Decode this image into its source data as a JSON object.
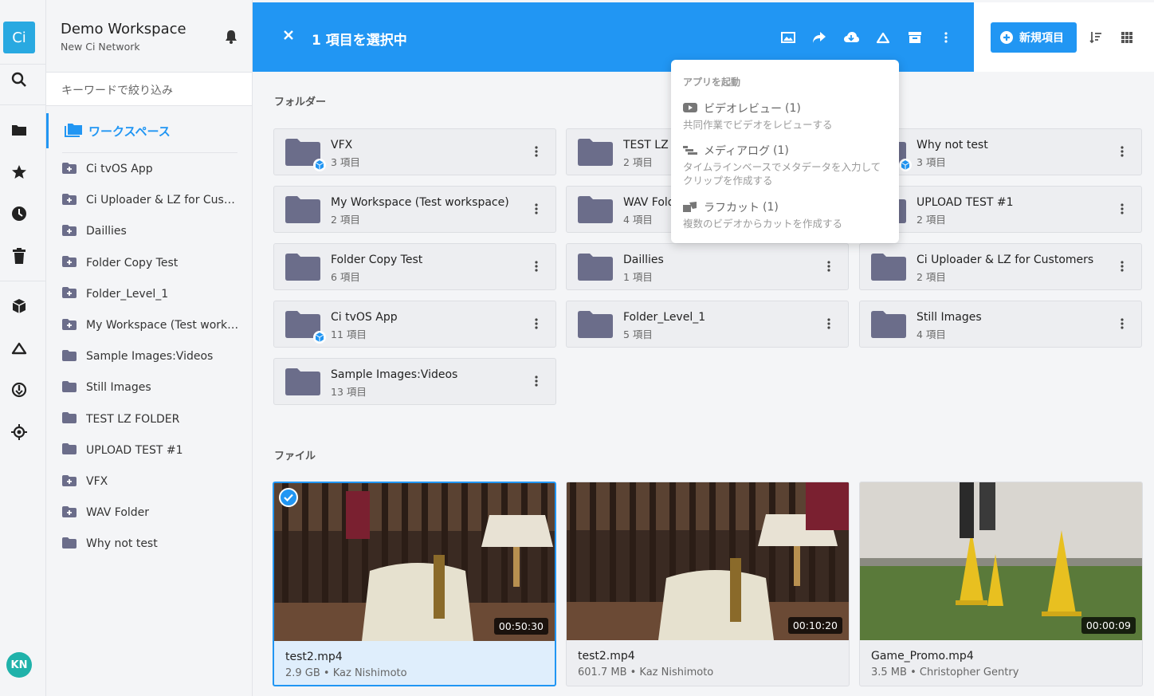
{
  "rail": {
    "logo": "Ci",
    "avatar": "KN",
    "icons": [
      "search-icon",
      "folder-icon",
      "star-icon",
      "clock-icon",
      "trash-icon",
      "cube-icon",
      "cloud-icon",
      "power-icon",
      "target-icon"
    ]
  },
  "workspace": {
    "title": "Demo Workspace",
    "subtitle": "New Ci Network"
  },
  "sidebar": {
    "filter_placeholder": "キーワードで絞り込み",
    "active": "ワークスペース",
    "items": [
      {
        "label": "Ci tvOS App",
        "icon": "folder-plus"
      },
      {
        "label": "Ci Uploader & LZ for Customers",
        "icon": "folder-plus"
      },
      {
        "label": "Daillies",
        "icon": "folder-plus"
      },
      {
        "label": "Folder Copy Test",
        "icon": "folder-plus"
      },
      {
        "label": "Folder_Level_1",
        "icon": "folder-plus"
      },
      {
        "label": "My Workspace (Test workspace)",
        "icon": "folder-plus"
      },
      {
        "label": "Sample Images:Videos",
        "icon": "folder"
      },
      {
        "label": "Still Images",
        "icon": "folder"
      },
      {
        "label": "TEST LZ FOLDER",
        "icon": "folder"
      },
      {
        "label": "UPLOAD TEST #1",
        "icon": "folder"
      },
      {
        "label": "VFX",
        "icon": "folder-plus"
      },
      {
        "label": "WAV Folder",
        "icon": "folder-plus"
      },
      {
        "label": "Why not test",
        "icon": "folder"
      }
    ]
  },
  "topbar": {
    "selection_text": "1 項目を選択中",
    "new_label": "新規項目"
  },
  "main": {
    "folders_label": "フォルダー",
    "files_label": "ファイル",
    "folders": [
      {
        "name": "VFX",
        "count": "3 項目",
        "shared": true
      },
      {
        "name": "TEST LZ FOLDER",
        "count": "2 項目",
        "shared": false
      },
      {
        "name": "Why not test",
        "count": "3 項目",
        "shared": true
      },
      {
        "name": "My Workspace (Test workspace)",
        "count": "2 項目",
        "shared": false
      },
      {
        "name": "WAV Folder",
        "count": "4 項目",
        "shared": false
      },
      {
        "name": "UPLOAD TEST #1",
        "count": "2 項目",
        "shared": false
      },
      {
        "name": "Folder Copy Test",
        "count": "6 項目",
        "shared": false
      },
      {
        "name": "Daillies",
        "count": "1 項目",
        "shared": false
      },
      {
        "name": "Ci Uploader & LZ for Customers",
        "count": "2 項目",
        "shared": false
      },
      {
        "name": "Ci tvOS App",
        "count": "11 項目",
        "shared": true
      },
      {
        "name": "Folder_Level_1",
        "count": "5 項目",
        "shared": false
      },
      {
        "name": "Still Images",
        "count": "4 項目",
        "shared": false
      },
      {
        "name": "Sample Images:Videos",
        "count": "13 項目",
        "shared": false
      }
    ],
    "files": [
      {
        "name": "test2.mp4",
        "meta": "2.9 GB • Kaz Nishimoto",
        "duration": "00:50:30",
        "selected": true
      },
      {
        "name": "test2.mp4",
        "meta": "601.7 MB • Kaz Nishimoto",
        "duration": "00:10:20",
        "selected": false
      },
      {
        "name": "Game_Promo.mp4",
        "meta": "3.5 MB • Christopher Gentry",
        "duration": "00:00:09",
        "selected": false
      }
    ]
  },
  "dropdown": {
    "header": "アプリを起動",
    "items": [
      {
        "title": "ビデオレビュー",
        "count": "(1)",
        "desc": "共同作業でビデオをレビューする"
      },
      {
        "title": "メディアログ",
        "count": "(1)",
        "desc": "タイムラインベースでメタデータを入力してクリップを作成する"
      },
      {
        "title": "ラフカット",
        "count": "(1)",
        "desc": "複数のビデオからカットを作成する"
      }
    ]
  },
  "colors": {
    "accent": "#2196f3",
    "folder": "#6b6d8a",
    "shared_badge": "#2196f3"
  }
}
